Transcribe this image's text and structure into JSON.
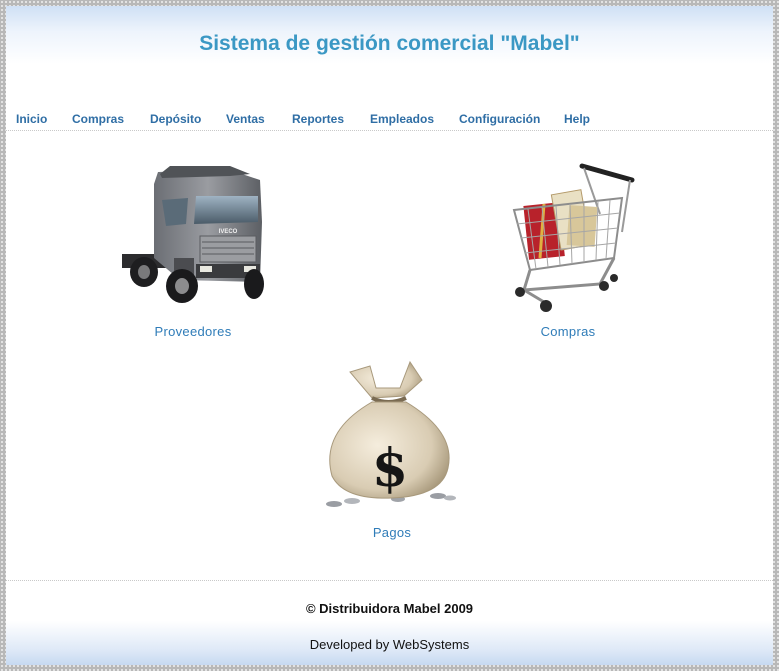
{
  "header": {
    "title": "Sistema de gestión comercial \"Mabel\""
  },
  "nav": {
    "items": [
      {
        "label": "Inicio"
      },
      {
        "label": "Compras"
      },
      {
        "label": "Depósito"
      },
      {
        "label": "Ventas"
      },
      {
        "label": "Reportes"
      },
      {
        "label": "Empleados"
      },
      {
        "label": "Configuración"
      },
      {
        "label": "Help"
      }
    ]
  },
  "main": {
    "tiles": [
      {
        "label": "Proveedores",
        "icon": "truck-icon"
      },
      {
        "label": "Compras",
        "icon": "shopping-cart-icon"
      },
      {
        "label": "Pagos",
        "icon": "money-bag-icon"
      }
    ],
    "truck_badge": "IVECO",
    "bag_symbol": "$"
  },
  "footer": {
    "copyright": "© Distribuidora Mabel 2009",
    "developed": "Developed by WebSystems"
  },
  "colors": {
    "title": "#3b98c4",
    "nav_link": "#2f6ea5",
    "tile_link": "#2f7cb8",
    "header_gradient_top": "#cfe0f5"
  }
}
